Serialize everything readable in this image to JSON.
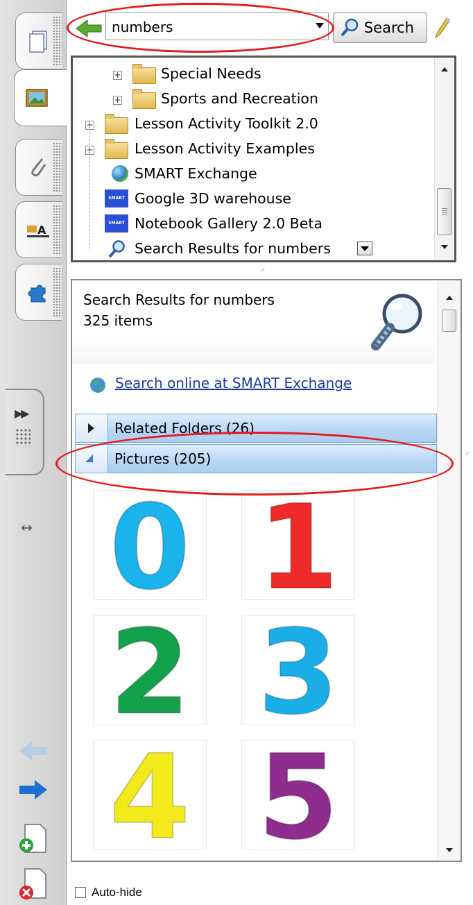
{
  "search": {
    "query": "numbers",
    "button_label": "Search"
  },
  "tree": {
    "items": [
      {
        "label": "Special Needs",
        "icon": "folder",
        "expandable": true
      },
      {
        "label": "Sports and Recreation",
        "icon": "folder",
        "expandable": true
      },
      {
        "label": "Lesson Activity Toolkit 2.0",
        "icon": "folder",
        "expandable": true
      },
      {
        "label": "Lesson Activity Examples",
        "icon": "folder",
        "expandable": true
      },
      {
        "label": "SMART Exchange",
        "icon": "globe-icon"
      },
      {
        "label": "Google 3D warehouse",
        "icon": "smart-logo-icon"
      },
      {
        "label": "Notebook Gallery 2.0 Beta",
        "icon": "smart-logo-icon"
      },
      {
        "label": "Search Results for numbers",
        "icon": "search-icon",
        "selected": true
      }
    ]
  },
  "results": {
    "title": "Search Results for numbers",
    "count": "325 items",
    "online_link": "Search online at SMART Exchange",
    "sections": [
      {
        "label": "Related Folders (26)",
        "expanded": false
      },
      {
        "label": "Pictures (205)",
        "expanded": true
      }
    ],
    "pictures": [
      {
        "glyph": "0",
        "color": "#1ab3ec"
      },
      {
        "glyph": "1",
        "color": "#ee2a2a"
      },
      {
        "glyph": "2",
        "color": "#14a14b"
      },
      {
        "glyph": "3",
        "color": "#1aaee8"
      },
      {
        "glyph": "4",
        "color": "#f2ea1b"
      },
      {
        "glyph": "5",
        "color": "#8e2d8e"
      }
    ]
  },
  "footer": {
    "autohide_label": "Auto-hide"
  },
  "colors": {
    "highlight_ellipse": "#e51b1b",
    "section_bar": "#bcd9f5",
    "link": "#1a3b9c"
  },
  "icons": {
    "side_tabs": [
      "page-sorter-icon",
      "gallery-icon",
      "attachments-icon",
      "properties-icon",
      "add-ons-icon"
    ],
    "nav": [
      "back-arrow-icon",
      "forward-arrow-icon",
      "add-page-icon",
      "delete-page-icon"
    ]
  }
}
